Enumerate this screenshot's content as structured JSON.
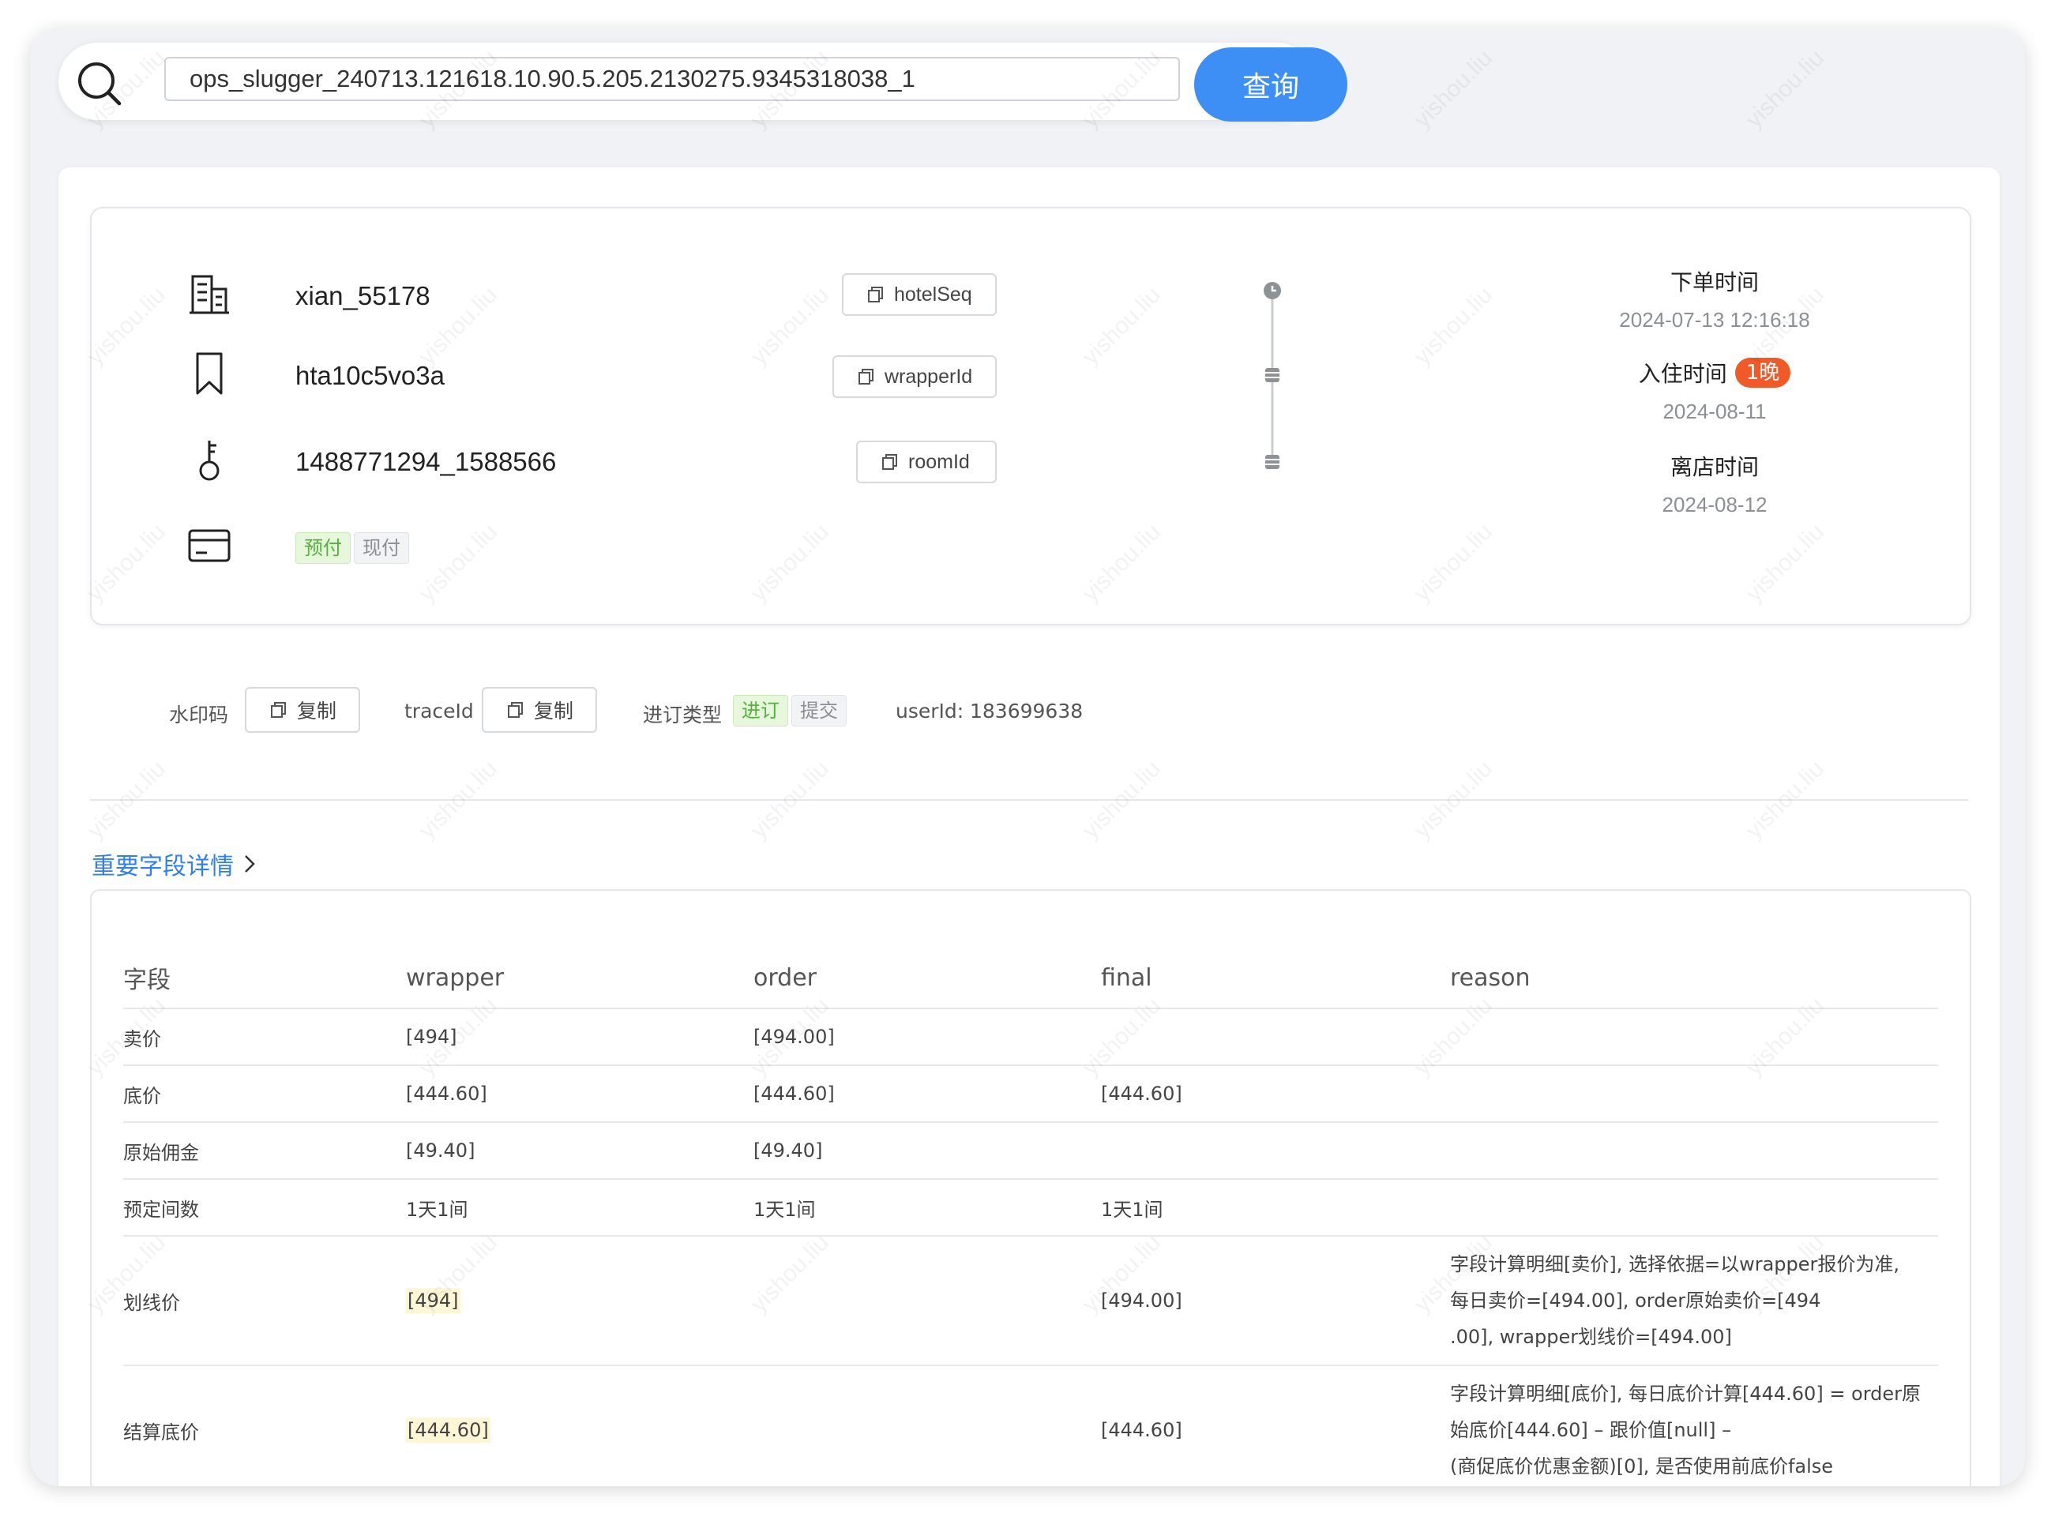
{
  "search": {
    "value": "ops_slugger_240713.121618.10.90.5.205.2130275.9345318038_1",
    "button_label": "查询"
  },
  "watermark": "yishou.liu",
  "info": {
    "hotel": {
      "value": "xian_55178",
      "copy_label": "hotelSeq"
    },
    "wrapper": {
      "value": "hta10c5vo3a",
      "copy_label": "wrapperId"
    },
    "room": {
      "value": "1488771294_1588566",
      "copy_label": "roomId"
    },
    "payment_tags": [
      "预付",
      "现付"
    ],
    "times": {
      "order": {
        "label": "下单时间",
        "value": "2024-07-13 12:16:18"
      },
      "checkin": {
        "label": "入住时间",
        "value": "2024-08-11",
        "badge": "1晚"
      },
      "checkout": {
        "label": "离店时间",
        "value": "2024-08-12"
      }
    }
  },
  "meta": {
    "watermark_label": "水印码",
    "watermark_copy": "复制",
    "traceid_label": "traceId",
    "traceid_copy": "复制",
    "booking_type_label": "进订类型",
    "booking_tags": [
      "进订",
      "提交"
    ],
    "userid_label": "userId:",
    "userid_value": "183699638"
  },
  "section": {
    "title": "重要字段详情"
  },
  "table": {
    "headers": [
      "字段",
      "wrapper",
      "order",
      "final",
      "reason"
    ],
    "rows": [
      {
        "field": "卖价",
        "wrapper": "[494]",
        "order": "[494.00]",
        "final": "",
        "reason": ""
      },
      {
        "field": "底价",
        "wrapper": "[444.60]",
        "order": "[444.60]",
        "final": "[444.60]",
        "reason": ""
      },
      {
        "field": "原始佣金",
        "wrapper": "[49.40]",
        "order": "[49.40]",
        "final": "",
        "reason": ""
      },
      {
        "field": "预定间数",
        "wrapper": "1天1间",
        "order": "1天1间",
        "final": "1天1间",
        "reason": ""
      },
      {
        "field": "划线价",
        "wrapper": "[494]",
        "order": "",
        "final": "[494.00]",
        "reason_lines": [
          "字段计算明细[卖价], 选择依据=以wrapper报价为准,",
          "每日卖价=[494.00], order原始卖价=[494",
          ".00], wrapper划线价=[494.00]"
        ]
      },
      {
        "field": "结算底价",
        "wrapper": "[444.60]",
        "order": "",
        "final": "[444.60]",
        "reason_lines": [
          "字段计算明细[底价], 每日底价计算[444.60] = order原",
          "始底价[444.60] – 跟价值[null] –",
          "(商促底价优惠金额)[0], 是否使用前底价false"
        ]
      }
    ]
  },
  "colors": {
    "accent": "#3d8ef5",
    "link": "#2f7ff0",
    "badge": "#ef5a28",
    "tag_green": "#52b23a",
    "highlight": "#fff6d6"
  }
}
